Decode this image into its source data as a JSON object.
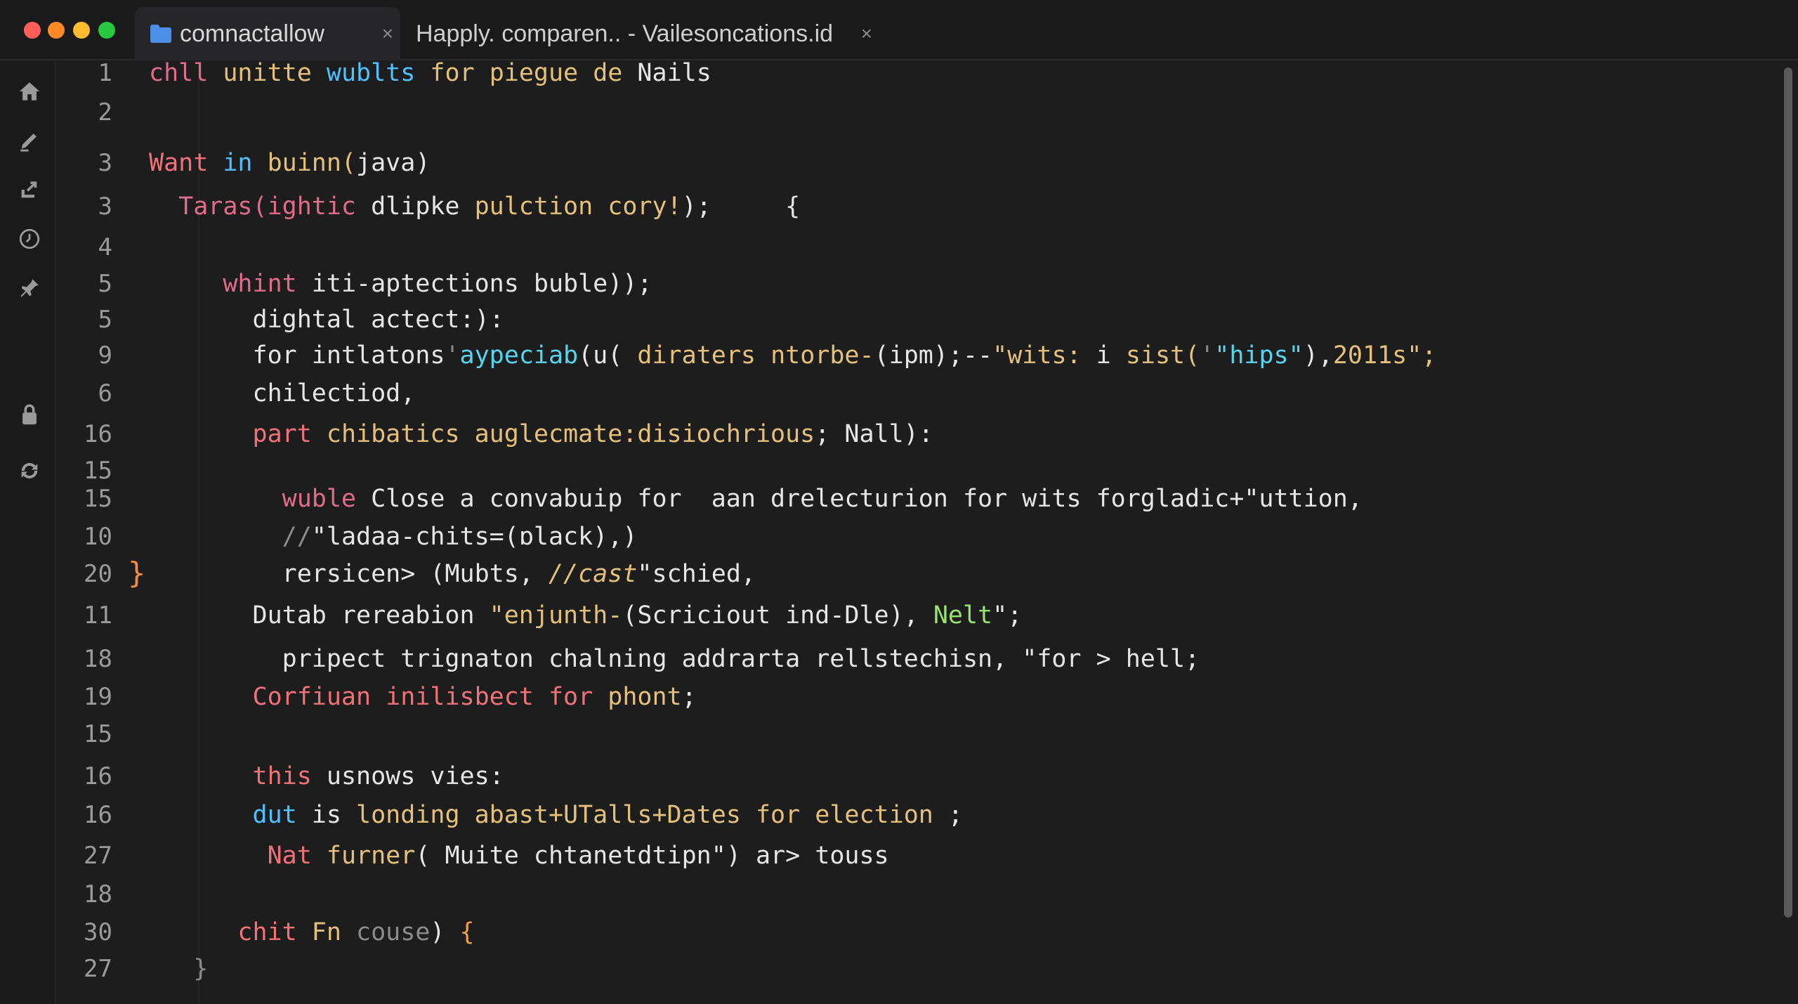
{
  "tabs": [
    {
      "label": "comnactallow",
      "active": true,
      "close": "×"
    },
    {
      "label": "Happly. comparen.. - Vailesoncations.id",
      "active": false,
      "close": "×"
    }
  ],
  "activity_icons": [
    "home-icon",
    "edit-icon",
    "share-icon",
    "history-icon",
    "pin-icon",
    "lock-icon",
    "sync-icon"
  ],
  "colors": {
    "accent": "#4c8ee8",
    "fold_marker": "#f58b3c",
    "background": "#1d1d1e"
  },
  "editor": {
    "fold_marker": "}",
    "lines": [
      {
        "n": "1",
        "segments": [
          [
            "chll ",
            "t-pink"
          ],
          [
            "unitte ",
            "t-yellow"
          ],
          [
            "wublts ",
            "t-blue"
          ],
          [
            "for ",
            "t-yellow"
          ],
          [
            "piegue ",
            "t-yellow"
          ],
          [
            "de ",
            "t-yellow"
          ],
          [
            "Nails",
            "t-white"
          ]
        ]
      },
      {
        "n": "2",
        "segments": []
      },
      {
        "n": "3",
        "segments": [
          [
            "Want ",
            "t-red"
          ],
          [
            "in ",
            "t-blue"
          ],
          [
            "buinn(",
            "t-yellow"
          ],
          [
            "java",
            "t-white"
          ],
          [
            ")",
            "t-white"
          ]
        ]
      },
      {
        "n": "3",
        "segments": [
          [
            "  Taras(ightic ",
            "t-pink"
          ],
          [
            "dlipke ",
            "t-white"
          ],
          [
            "pulction ",
            "t-yellow"
          ],
          [
            "cory!",
            "t-yellow"
          ],
          [
            ");     {",
            "t-white"
          ]
        ]
      },
      {
        "n": "4",
        "segments": []
      },
      {
        "n": "5",
        "segments": [
          [
            "     whint ",
            "t-pink"
          ],
          [
            "iti-aptections buble));",
            "t-white"
          ]
        ]
      },
      {
        "n": "5",
        "segments": [
          [
            "       dightal actect:):",
            "t-white"
          ]
        ]
      },
      {
        "n": "9",
        "segments": [
          [
            "       for ",
            "t-white"
          ],
          [
            "intlatons",
            "t-white"
          ],
          [
            "'",
            "t-grey"
          ],
          [
            "aypeciab",
            "t-cyan"
          ],
          [
            "(u( ",
            "t-white"
          ],
          [
            "diraters ",
            "t-yellow"
          ],
          [
            "ntorbe-",
            "t-yellow"
          ],
          [
            "(ipm);--",
            "t-white"
          ],
          [
            "\"wits: ",
            "t-yellow"
          ],
          [
            "i ",
            "t-white"
          ],
          [
            "sist(",
            "t-yellow"
          ],
          [
            "'",
            "t-grey"
          ],
          [
            "\"hips\"",
            "t-cyan"
          ],
          [
            "),",
            "t-white"
          ],
          [
            "2011s\";",
            "t-yellow"
          ]
        ]
      },
      {
        "n": "6",
        "segments": [
          [
            "       chilectiod,",
            "t-white"
          ]
        ]
      },
      {
        "n": "16",
        "segments": [
          [
            "       part ",
            "t-red"
          ],
          [
            "chibatics ",
            "t-yellow"
          ],
          [
            "auglecmate:disiochrious",
            "t-yellow"
          ],
          [
            "; Nall):",
            "t-white"
          ]
        ]
      },
      {
        "n": "15",
        "segments": []
      },
      {
        "n": "15",
        "segments": [
          [
            "         wuble ",
            "t-pink"
          ],
          [
            "Close a convabuip for  aan drelecturion for wits forgladic+\"uttion,",
            "t-white"
          ]
        ]
      },
      {
        "n": "10",
        "segments": [
          [
            "         //",
            "t-grey"
          ],
          [
            "\"ladaa-chits=(",
            "t-white"
          ],
          [
            "ɒlack",
            "t-white"
          ],
          [
            "),)",
            "t-white"
          ]
        ]
      },
      {
        "n": "20",
        "segments": [
          [
            "         rersicen> (Mubts, ",
            "t-white"
          ],
          [
            "//cast",
            "t-ital"
          ],
          [
            "\"schied,",
            "t-white"
          ]
        ],
        "fold": true
      },
      {
        "n": "11",
        "segments": [
          [
            "       Dutab rereabion ",
            "t-white"
          ],
          [
            "\"enjunth-",
            "t-yellow"
          ],
          [
            "(Scriciout ind-Dle), ",
            "t-white"
          ],
          [
            "Nelt",
            "t-green"
          ],
          [
            "\";",
            "t-white"
          ]
        ]
      },
      {
        "n": "18",
        "segments": [
          [
            "         pripect trignaton chalning addrarta rellstechisn, \"for > hell;",
            "t-white"
          ]
        ]
      },
      {
        "n": "19",
        "segments": [
          [
            "       Corfiuan ",
            "t-red"
          ],
          [
            "inilisbect ",
            "t-red"
          ],
          [
            "for ",
            "t-red"
          ],
          [
            "phont",
            "t-yellow"
          ],
          [
            ";",
            "t-white"
          ]
        ]
      },
      {
        "n": "15",
        "segments": []
      },
      {
        "n": "16",
        "segments": [
          [
            "       this ",
            "t-red"
          ],
          [
            "usnows vies:",
            "t-white"
          ]
        ]
      },
      {
        "n": "16",
        "segments": [
          [
            "       dut ",
            "t-blue"
          ],
          [
            "is ",
            "t-white"
          ],
          [
            "londing ",
            "t-yellow"
          ],
          [
            "abast+UTalls+Dates ",
            "t-yellow"
          ],
          [
            "for ",
            "t-yellow"
          ],
          [
            "election ",
            "t-yellow"
          ],
          [
            ";",
            "t-white"
          ]
        ]
      },
      {
        "n": "27",
        "segments": [
          [
            "        Nat ",
            "t-red"
          ],
          [
            "furner",
            "t-yellow"
          ],
          [
            "( Muite chtanetdtipn\") ar> touss",
            "t-white"
          ]
        ]
      },
      {
        "n": "18",
        "segments": []
      },
      {
        "n": "30",
        "segments": [
          [
            "      chit ",
            "t-red"
          ],
          [
            "Fn ",
            "t-yellow"
          ],
          [
            "couse",
            "t-grey"
          ],
          [
            ") ",
            "t-white"
          ],
          [
            "{",
            "t-orange"
          ]
        ]
      },
      {
        "n": "27",
        "segments": [
          [
            "   }",
            "t-grey"
          ]
        ]
      }
    ]
  }
}
